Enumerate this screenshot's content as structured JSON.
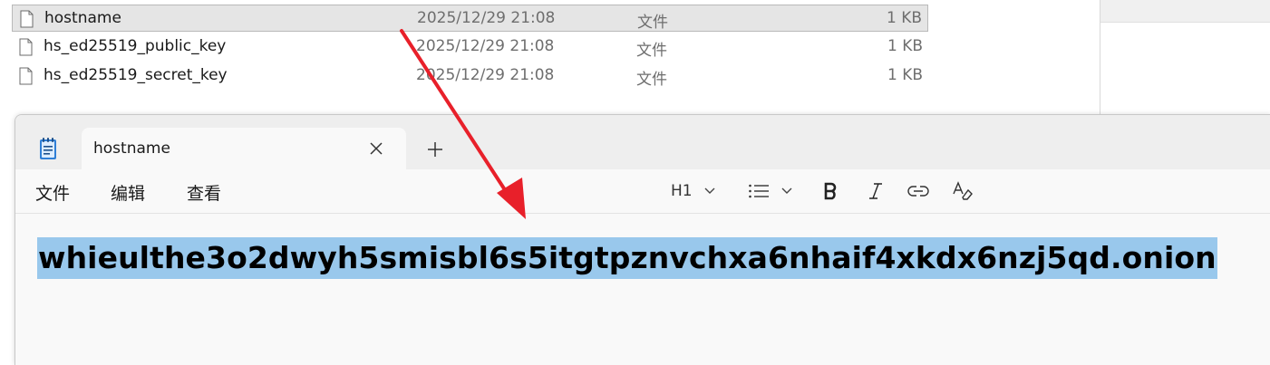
{
  "explorer": {
    "files": [
      {
        "name": "hostname",
        "date": "2025/12/29 21:08",
        "type": "文件",
        "size": "1 KB",
        "selected": true
      },
      {
        "name": "hs_ed25519_public_key",
        "date": "2025/12/29 21:08",
        "type": "文件",
        "size": "1 KB",
        "selected": false
      },
      {
        "name": "hs_ed25519_secret_key",
        "date": "2025/12/29 21:08",
        "type": "文件",
        "size": "1 KB",
        "selected": false
      }
    ]
  },
  "notepad": {
    "tab_title": "hostname",
    "menu": [
      "文件",
      "编辑",
      "查看"
    ],
    "toolbar": {
      "heading": "H1",
      "icons": [
        "list-icon",
        "bold-icon",
        "italic-icon",
        "link-icon",
        "clear-formatting-icon"
      ]
    },
    "content": "whieulthe3o2dwyh5smisbl6s5itgtpznvchxa6nhaif4xkdx6nzj5qd.onion",
    "selection_color": "#99c8ec"
  },
  "annotation": {
    "arrow_color": "#e8202a"
  }
}
